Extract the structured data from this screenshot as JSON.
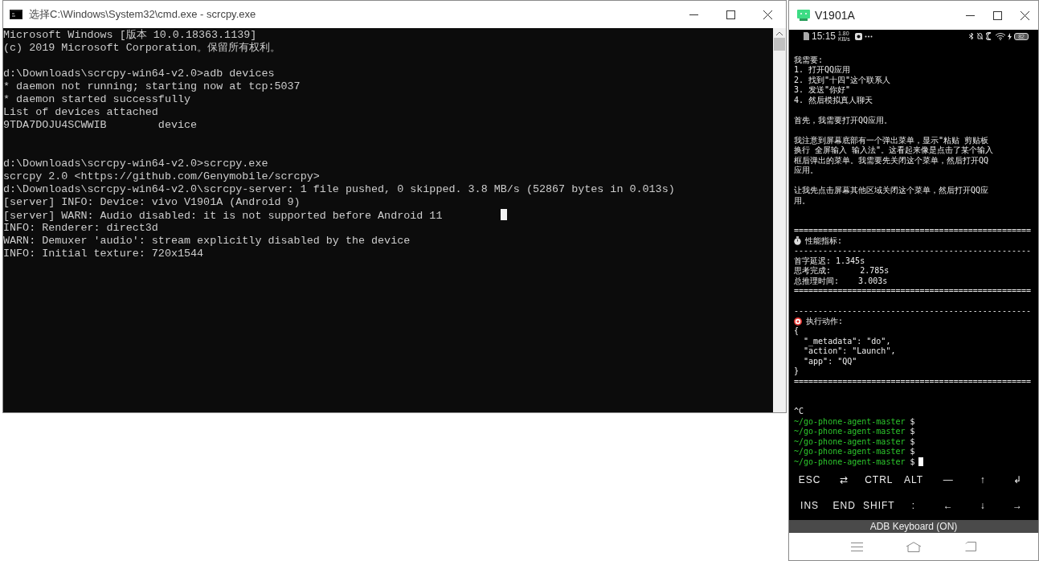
{
  "console_window": {
    "title": "选择C:\\Windows\\System32\\cmd.exe - scrcpy.exe",
    "lines": [
      {
        "kind": "text",
        "text": "Microsoft Windows [版本 10.0.18363.1139]"
      },
      {
        "kind": "text",
        "text": "(c) 2019 Microsoft Corporation。保留所有权利。"
      },
      {
        "kind": "blank"
      },
      {
        "kind": "text",
        "text": "d:\\Downloads\\scrcpy-win64-v2.0>adb devices"
      },
      {
        "kind": "text",
        "text": "* daemon not running; starting now at tcp:5037"
      },
      {
        "kind": "text",
        "text": "* daemon started successfully"
      },
      {
        "kind": "text",
        "text": "List of devices attached"
      },
      {
        "kind": "columns",
        "cells": [
          "9TDA7DOJU4SCWWIB",
          "device"
        ]
      },
      {
        "kind": "blank"
      },
      {
        "kind": "blank"
      },
      {
        "kind": "text",
        "text": "d:\\Downloads\\scrcpy-win64-v2.0>scrcpy.exe"
      },
      {
        "kind": "text",
        "text": "scrcpy 2.0 <https://github.com/Genymobile/scrcpy>"
      },
      {
        "kind": "text",
        "text": "d:\\Downloads\\scrcpy-win64-v2.0\\scrcpy-server: 1 file pushed, 0 skipped. 3.8 MB/s (52867 bytes in 0.013s)"
      },
      {
        "kind": "text",
        "text": "[server] INFO: Device: vivo V1901A (Android 9)"
      },
      {
        "kind": "text",
        "text": "[server] WARN: Audio disabled: it is not supported before Android 11",
        "cursor": true
      },
      {
        "kind": "text",
        "text": "INFO: Renderer: direct3d"
      },
      {
        "kind": "text",
        "text": "WARN: Demuxer 'audio': stream explicitly disabled by the device"
      },
      {
        "kind": "text",
        "text": "INFO: Initial texture: 720x1544"
      }
    ]
  },
  "phone_window": {
    "title": "V1901A",
    "status_bar": {
      "time": "15:15",
      "net_speed": "1.80 KB/s",
      "battery": "82"
    },
    "terminal": [
      {
        "kind": "text",
        "text": "我需要:"
      },
      {
        "kind": "text",
        "text": "1. 打开QQ应用"
      },
      {
        "kind": "text",
        "text": "2. 找到\"十四\"这个联系人"
      },
      {
        "kind": "text",
        "text": "3. 发送\"你好\""
      },
      {
        "kind": "text",
        "text": "4. 然后模拟真人聊天"
      },
      {
        "kind": "blank"
      },
      {
        "kind": "text",
        "text": "首先，我需要打开QQ应用。"
      },
      {
        "kind": "blank"
      },
      {
        "kind": "text",
        "text": "我注意到屏幕底部有一个弹出菜单，显示\"粘贴 剪贴板"
      },
      {
        "kind": "text",
        "text": "换行 全屏输入 输入法\"。这看起来像是点击了某个输入"
      },
      {
        "kind": "text",
        "text": "框后弹出的菜单。我需要先关闭这个菜单，然后打开QQ"
      },
      {
        "kind": "text",
        "text": "应用。"
      },
      {
        "kind": "blank"
      },
      {
        "kind": "text",
        "text": "让我先点击屏幕其他区域关闭这个菜单，然后打开QQ应"
      },
      {
        "kind": "text",
        "text": "用。"
      },
      {
        "kind": "blank"
      },
      {
        "kind": "blank"
      },
      {
        "kind": "rule",
        "text": "================================================="
      },
      {
        "kind": "stopwatch",
        "text": "性能指标:"
      },
      {
        "kind": "rule",
        "text": "-------------------------------------------------"
      },
      {
        "kind": "text",
        "text": "首字延迟: 1.345s"
      },
      {
        "kind": "text",
        "text": "思考完成:      2.785s"
      },
      {
        "kind": "text",
        "text": "总推理时间:    3.003s"
      },
      {
        "kind": "rule",
        "text": "================================================="
      },
      {
        "kind": "blank"
      },
      {
        "kind": "rule",
        "text": "-------------------------------------------------"
      },
      {
        "kind": "target",
        "text": "执行动作:"
      },
      {
        "kind": "text",
        "text": "{"
      },
      {
        "kind": "text",
        "text": "  \"_metadata\": \"do\","
      },
      {
        "kind": "text",
        "text": "  \"action\": \"Launch\","
      },
      {
        "kind": "text",
        "text": "  \"app\": \"QQ\""
      },
      {
        "kind": "text",
        "text": "}"
      },
      {
        "kind": "rule",
        "text": "================================================="
      },
      {
        "kind": "blank"
      },
      {
        "kind": "blank"
      },
      {
        "kind": "text",
        "text": "^C"
      },
      {
        "kind": "prompt",
        "path": "~/go-phone-agent-master",
        "sign": "$"
      },
      {
        "kind": "prompt",
        "path": "~/go-phone-agent-master",
        "sign": "$"
      },
      {
        "kind": "prompt",
        "path": "~/go-phone-agent-master",
        "sign": "$"
      },
      {
        "kind": "prompt",
        "path": "~/go-phone-agent-master",
        "sign": "$"
      },
      {
        "kind": "prompt",
        "path": "~/go-phone-agent-master",
        "sign": "$",
        "cursor": true
      }
    ],
    "extra_keys": [
      [
        "ESC",
        "⇄",
        "CTRL",
        "ALT",
        "—",
        "↑",
        "↲"
      ],
      [
        "INS",
        "END",
        "SHIFT",
        ":",
        "←",
        "↓",
        "→"
      ]
    ],
    "keyboard_bar": "ADB Keyboard (ON)"
  }
}
